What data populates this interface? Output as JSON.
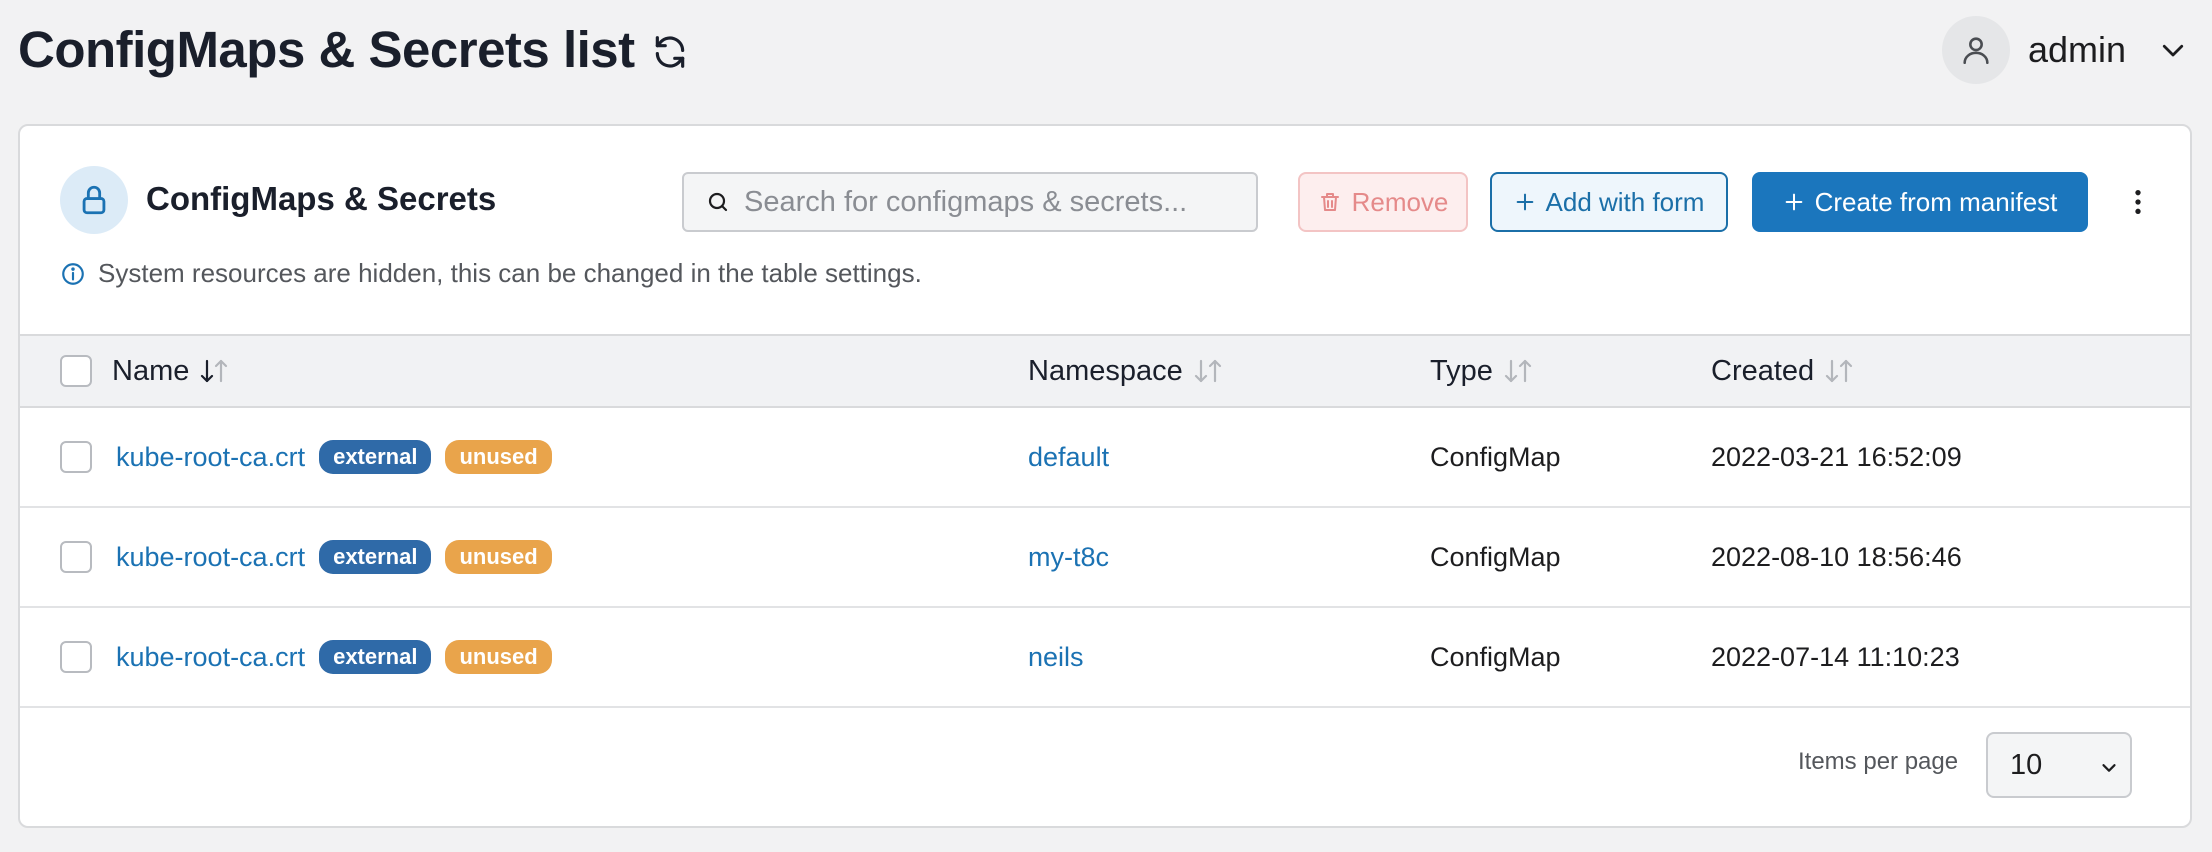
{
  "header": {
    "title": "ConfigMaps & Secrets list",
    "user": "admin"
  },
  "card": {
    "title": "ConfigMaps & Secrets",
    "search_placeholder": "Search for configmaps & secrets...",
    "buttons": {
      "remove": "Remove",
      "add": "Add with form",
      "create": "Create from manifest"
    },
    "info": "System resources are hidden, this can be changed in the table settings."
  },
  "table": {
    "columns": [
      "Name",
      "Namespace",
      "Type",
      "Created"
    ],
    "rows": [
      {
        "name": "kube-root-ca.crt",
        "badges": [
          "external",
          "unused"
        ],
        "namespace": "default",
        "type": "ConfigMap",
        "created": "2022-03-21 16:52:09"
      },
      {
        "name": "kube-root-ca.crt",
        "badges": [
          "external",
          "unused"
        ],
        "namespace": "my-t8c",
        "type": "ConfigMap",
        "created": "2022-08-10 18:56:46"
      },
      {
        "name": "kube-root-ca.crt",
        "badges": [
          "external",
          "unused"
        ],
        "namespace": "neils",
        "type": "ConfigMap",
        "created": "2022-07-14 11:10:23"
      }
    ]
  },
  "pagination": {
    "label": "Items per page",
    "value": "10"
  },
  "colors": {
    "primary": "#1b76bd",
    "link": "#1b72b3",
    "badge_external": "#2f6aa8",
    "badge_unused": "#e9a44b",
    "remove_text": "#e58a8a"
  }
}
